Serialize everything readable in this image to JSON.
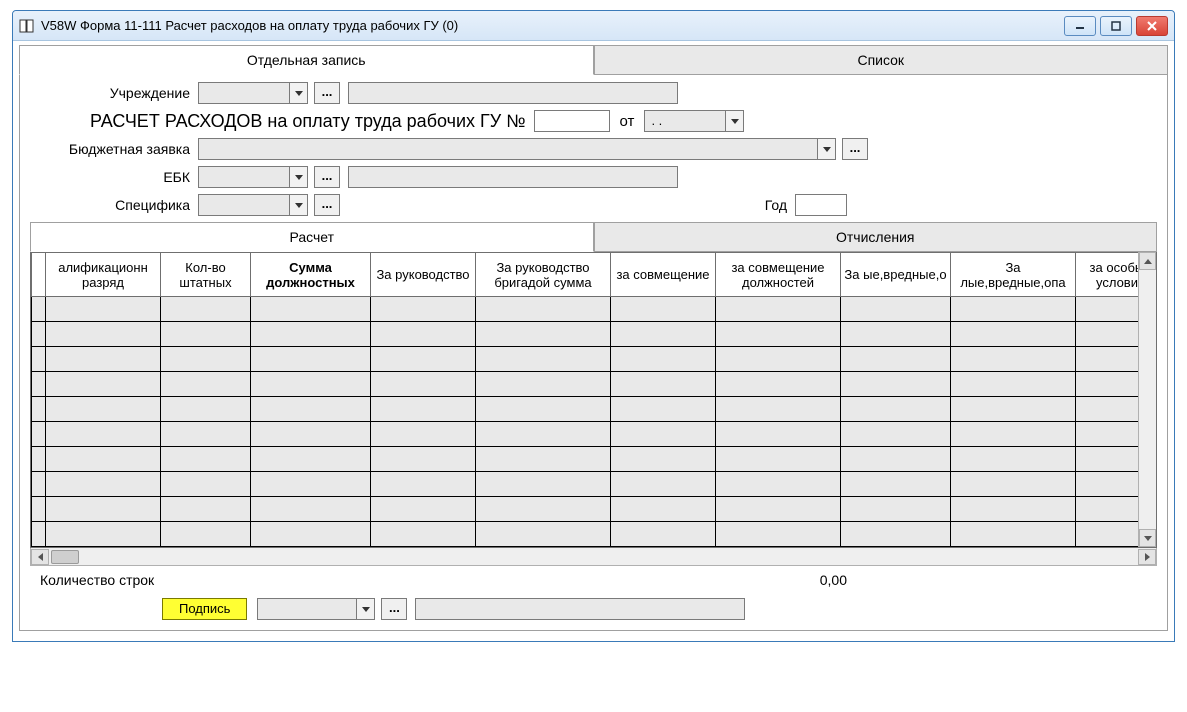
{
  "window": {
    "title": "V58W Форма 11-111 Расчет расходов на оплату труда рабочих ГУ (0)"
  },
  "top_tabs": {
    "single": "Отдельная запись",
    "list": "Список"
  },
  "labels": {
    "institution": "Учреждение",
    "calc_title": "РАСЧЕТ РАСХОДОВ на оплату труда рабочих ГУ №",
    "from": "от",
    "date_placeholder": " .  .",
    "budget_request": "Бюджетная заявка",
    "ebk": "ЕБК",
    "specifics": "Специфика",
    "year": "Год"
  },
  "sub_tabs": {
    "calc": "Расчет",
    "deductions": "Отчисления"
  },
  "columns": [
    "алификационн разряд",
    "Кол-во штатных",
    "Сумма должностных",
    "За руководство",
    "За руководство бригадой сумма",
    "за совмещение",
    "за совмещение должностей",
    "За ые,вредные,о",
    "За лые,вредные,опа",
    "за особые условия"
  ],
  "footer": {
    "rowcount_label": "Количество строк",
    "rowcount_value": "0,00"
  },
  "sign": {
    "button": "Подпись"
  }
}
